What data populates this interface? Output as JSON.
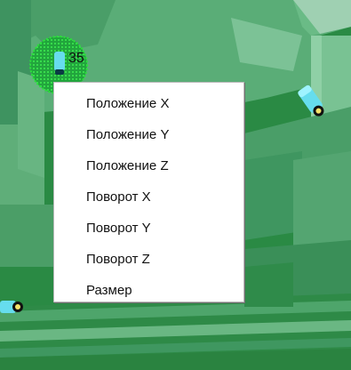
{
  "object_badge": {
    "number": "35",
    "highlight_color": "#22cc22"
  },
  "context_menu": {
    "items": [
      {
        "label": "Положение X"
      },
      {
        "label": "Положение Y"
      },
      {
        "label": "Положение Z"
      },
      {
        "label": "Поворот X"
      },
      {
        "label": "Поворот Y"
      },
      {
        "label": "Поворот Z"
      },
      {
        "label": "Размер"
      }
    ]
  },
  "colors": {
    "scene_green": "#2a8a44",
    "menu_background": "#ffffff",
    "camera_body": "#66ddee"
  }
}
